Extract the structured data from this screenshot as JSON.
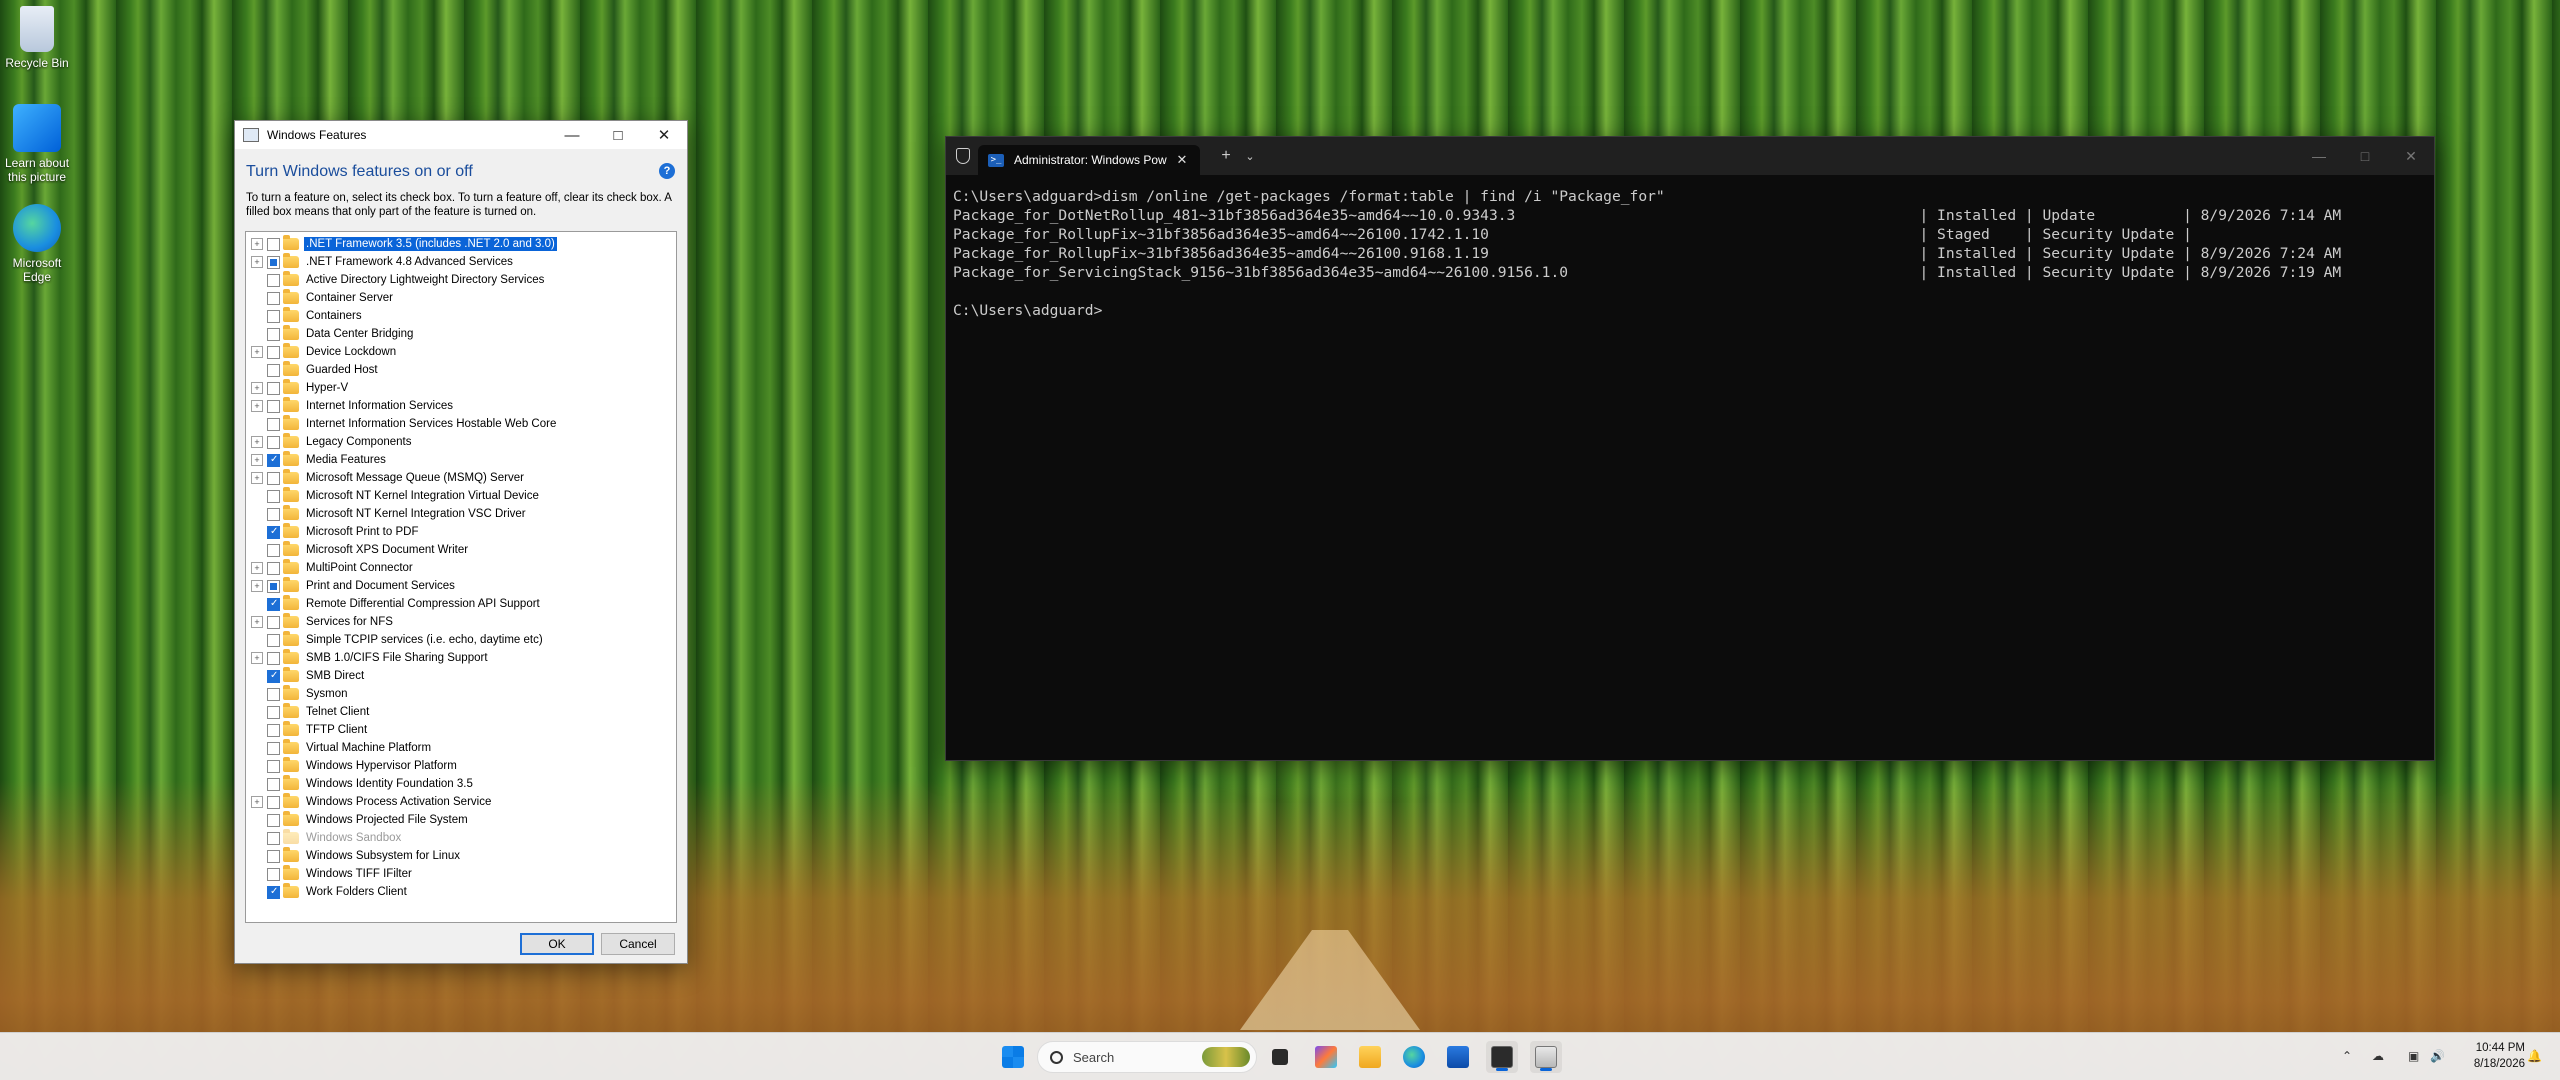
{
  "desktop": {
    "icons": [
      {
        "label": "Recycle Bin",
        "icon": "recycle-bin-icon"
      },
      {
        "label": "Learn about this picture",
        "icon": "learn-about-picture-icon"
      },
      {
        "label": "Microsoft Edge",
        "icon": "edge-icon"
      }
    ]
  },
  "features_dialog": {
    "title": "Windows Features",
    "heading": "Turn Windows features on or off",
    "description": "To turn a feature on, select its check box. To turn a feature off, clear its check box. A filled box means that only part of the feature is turned on.",
    "help_label": "?",
    "ok_label": "OK",
    "cancel_label": "Cancel",
    "items": [
      {
        "label": ".NET Framework 3.5 (includes .NET 2.0 and 3.0)",
        "expandable": true,
        "state": "unchecked",
        "selected": true,
        "disabled": false
      },
      {
        "label": ".NET Framework 4.8 Advanced Services",
        "expandable": true,
        "state": "partial",
        "selected": false,
        "disabled": false
      },
      {
        "label": "Active Directory Lightweight Directory Services",
        "expandable": false,
        "state": "unchecked",
        "selected": false,
        "disabled": false
      },
      {
        "label": "Container Server",
        "expandable": false,
        "state": "unchecked",
        "selected": false,
        "disabled": false
      },
      {
        "label": "Containers",
        "expandable": false,
        "state": "unchecked",
        "selected": false,
        "disabled": false
      },
      {
        "label": "Data Center Bridging",
        "expandable": false,
        "state": "unchecked",
        "selected": false,
        "disabled": false
      },
      {
        "label": "Device Lockdown",
        "expandable": true,
        "state": "unchecked",
        "selected": false,
        "disabled": false
      },
      {
        "label": "Guarded Host",
        "expandable": false,
        "state": "unchecked",
        "selected": false,
        "disabled": false
      },
      {
        "label": "Hyper-V",
        "expandable": true,
        "state": "unchecked",
        "selected": false,
        "disabled": false
      },
      {
        "label": "Internet Information Services",
        "expandable": true,
        "state": "unchecked",
        "selected": false,
        "disabled": false
      },
      {
        "label": "Internet Information Services Hostable Web Core",
        "expandable": false,
        "state": "unchecked",
        "selected": false,
        "disabled": false
      },
      {
        "label": "Legacy Components",
        "expandable": true,
        "state": "unchecked",
        "selected": false,
        "disabled": false
      },
      {
        "label": "Media Features",
        "expandable": true,
        "state": "checked",
        "selected": false,
        "disabled": false
      },
      {
        "label": "Microsoft Message Queue (MSMQ) Server",
        "expandable": true,
        "state": "unchecked",
        "selected": false,
        "disabled": false
      },
      {
        "label": "Microsoft NT Kernel Integration Virtual Device",
        "expandable": false,
        "state": "unchecked",
        "selected": false,
        "disabled": false
      },
      {
        "label": "Microsoft NT Kernel Integration VSC Driver",
        "expandable": false,
        "state": "unchecked",
        "selected": false,
        "disabled": false
      },
      {
        "label": "Microsoft Print to PDF",
        "expandable": false,
        "state": "checked",
        "selected": false,
        "disabled": false
      },
      {
        "label": "Microsoft XPS Document Writer",
        "expandable": false,
        "state": "unchecked",
        "selected": false,
        "disabled": false
      },
      {
        "label": "MultiPoint Connector",
        "expandable": true,
        "state": "unchecked",
        "selected": false,
        "disabled": false
      },
      {
        "label": "Print and Document Services",
        "expandable": true,
        "state": "partial",
        "selected": false,
        "disabled": false
      },
      {
        "label": "Remote Differential Compression API Support",
        "expandable": false,
        "state": "checked",
        "selected": false,
        "disabled": false
      },
      {
        "label": "Services for NFS",
        "expandable": true,
        "state": "unchecked",
        "selected": false,
        "disabled": false
      },
      {
        "label": "Simple TCPIP services (i.e. echo, daytime etc)",
        "expandable": false,
        "state": "unchecked",
        "selected": false,
        "disabled": false
      },
      {
        "label": "SMB 1.0/CIFS File Sharing Support",
        "expandable": true,
        "state": "unchecked",
        "selected": false,
        "disabled": false
      },
      {
        "label": "SMB Direct",
        "expandable": false,
        "state": "checked",
        "selected": false,
        "disabled": false
      },
      {
        "label": "Sysmon",
        "expandable": false,
        "state": "unchecked",
        "selected": false,
        "disabled": false
      },
      {
        "label": "Telnet Client",
        "expandable": false,
        "state": "unchecked",
        "selected": false,
        "disabled": false
      },
      {
        "label": "TFTP Client",
        "expandable": false,
        "state": "unchecked",
        "selected": false,
        "disabled": false
      },
      {
        "label": "Virtual Machine Platform",
        "expandable": false,
        "state": "unchecked",
        "selected": false,
        "disabled": false
      },
      {
        "label": "Windows Hypervisor Platform",
        "expandable": false,
        "state": "unchecked",
        "selected": false,
        "disabled": false
      },
      {
        "label": "Windows Identity Foundation 3.5",
        "expandable": false,
        "state": "unchecked",
        "selected": false,
        "disabled": false
      },
      {
        "label": "Windows Process Activation Service",
        "expandable": true,
        "state": "unchecked",
        "selected": false,
        "disabled": false
      },
      {
        "label": "Windows Projected File System",
        "expandable": false,
        "state": "unchecked",
        "selected": false,
        "disabled": false
      },
      {
        "label": "Windows Sandbox",
        "expandable": false,
        "state": "unchecked",
        "selected": false,
        "disabled": true
      },
      {
        "label": "Windows Subsystem for Linux",
        "expandable": false,
        "state": "unchecked",
        "selected": false,
        "disabled": false
      },
      {
        "label": "Windows TIFF IFilter",
        "expandable": false,
        "state": "unchecked",
        "selected": false,
        "disabled": false
      },
      {
        "label": "Work Folders Client",
        "expandable": false,
        "state": "checked",
        "selected": false,
        "disabled": false
      }
    ]
  },
  "terminal": {
    "tab_title": "Administrator: Windows Pow",
    "new_tab_label": "+",
    "lines": [
      "C:\\Users\\adguard>dism /online /get-packages /format:table | find /i \"Package_for\"",
      "Package_for_DotNetRollup_481~31bf3856ad364e35~amd64~~10.0.9343.3                                              | Installed | Update          | 8/9/2026 7:14 AM",
      "Package_for_RollupFix~31bf3856ad364e35~amd64~~26100.1742.1.10                                                 | Staged    | Security Update |",
      "Package_for_RollupFix~31bf3856ad364e35~amd64~~26100.9168.1.19                                                 | Installed | Security Update | 8/9/2026 7:24 AM",
      "Package_for_ServicingStack_9156~31bf3856ad364e35~amd64~~26100.9156.1.0                                        | Installed | Security Update | 8/9/2026 7:19 AM",
      "",
      "C:\\Users\\adguard>"
    ]
  },
  "taskbar": {
    "search_placeholder": "Search",
    "time": "10:44 PM",
    "date": "8/18/2026",
    "accent": "#0a64d8"
  }
}
